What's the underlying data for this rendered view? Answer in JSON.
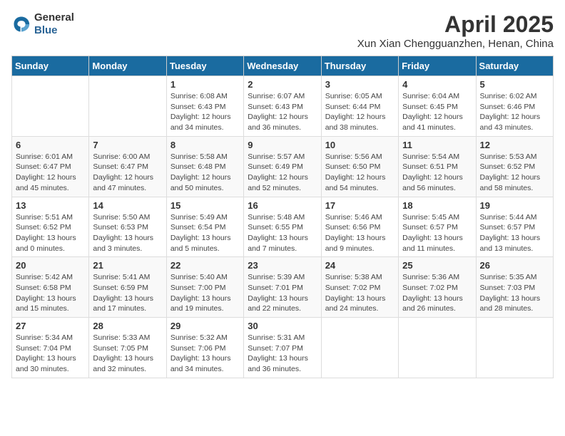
{
  "header": {
    "logo_line1": "General",
    "logo_line2": "Blue",
    "title": "April 2025",
    "subtitle": "Xun Xian Chengguanzhen, Henan, China"
  },
  "weekdays": [
    "Sunday",
    "Monday",
    "Tuesday",
    "Wednesday",
    "Thursday",
    "Friday",
    "Saturday"
  ],
  "weeks": [
    [
      {
        "day": "",
        "info": ""
      },
      {
        "day": "",
        "info": ""
      },
      {
        "day": "1",
        "info": "Sunrise: 6:08 AM\nSunset: 6:43 PM\nDaylight: 12 hours\nand 34 minutes."
      },
      {
        "day": "2",
        "info": "Sunrise: 6:07 AM\nSunset: 6:43 PM\nDaylight: 12 hours\nand 36 minutes."
      },
      {
        "day": "3",
        "info": "Sunrise: 6:05 AM\nSunset: 6:44 PM\nDaylight: 12 hours\nand 38 minutes."
      },
      {
        "day": "4",
        "info": "Sunrise: 6:04 AM\nSunset: 6:45 PM\nDaylight: 12 hours\nand 41 minutes."
      },
      {
        "day": "5",
        "info": "Sunrise: 6:02 AM\nSunset: 6:46 PM\nDaylight: 12 hours\nand 43 minutes."
      }
    ],
    [
      {
        "day": "6",
        "info": "Sunrise: 6:01 AM\nSunset: 6:47 PM\nDaylight: 12 hours\nand 45 minutes."
      },
      {
        "day": "7",
        "info": "Sunrise: 6:00 AM\nSunset: 6:47 PM\nDaylight: 12 hours\nand 47 minutes."
      },
      {
        "day": "8",
        "info": "Sunrise: 5:58 AM\nSunset: 6:48 PM\nDaylight: 12 hours\nand 50 minutes."
      },
      {
        "day": "9",
        "info": "Sunrise: 5:57 AM\nSunset: 6:49 PM\nDaylight: 12 hours\nand 52 minutes."
      },
      {
        "day": "10",
        "info": "Sunrise: 5:56 AM\nSunset: 6:50 PM\nDaylight: 12 hours\nand 54 minutes."
      },
      {
        "day": "11",
        "info": "Sunrise: 5:54 AM\nSunset: 6:51 PM\nDaylight: 12 hours\nand 56 minutes."
      },
      {
        "day": "12",
        "info": "Sunrise: 5:53 AM\nSunset: 6:52 PM\nDaylight: 12 hours\nand 58 minutes."
      }
    ],
    [
      {
        "day": "13",
        "info": "Sunrise: 5:51 AM\nSunset: 6:52 PM\nDaylight: 13 hours\nand 0 minutes."
      },
      {
        "day": "14",
        "info": "Sunrise: 5:50 AM\nSunset: 6:53 PM\nDaylight: 13 hours\nand 3 minutes."
      },
      {
        "day": "15",
        "info": "Sunrise: 5:49 AM\nSunset: 6:54 PM\nDaylight: 13 hours\nand 5 minutes."
      },
      {
        "day": "16",
        "info": "Sunrise: 5:48 AM\nSunset: 6:55 PM\nDaylight: 13 hours\nand 7 minutes."
      },
      {
        "day": "17",
        "info": "Sunrise: 5:46 AM\nSunset: 6:56 PM\nDaylight: 13 hours\nand 9 minutes."
      },
      {
        "day": "18",
        "info": "Sunrise: 5:45 AM\nSunset: 6:57 PM\nDaylight: 13 hours\nand 11 minutes."
      },
      {
        "day": "19",
        "info": "Sunrise: 5:44 AM\nSunset: 6:57 PM\nDaylight: 13 hours\nand 13 minutes."
      }
    ],
    [
      {
        "day": "20",
        "info": "Sunrise: 5:42 AM\nSunset: 6:58 PM\nDaylight: 13 hours\nand 15 minutes."
      },
      {
        "day": "21",
        "info": "Sunrise: 5:41 AM\nSunset: 6:59 PM\nDaylight: 13 hours\nand 17 minutes."
      },
      {
        "day": "22",
        "info": "Sunrise: 5:40 AM\nSunset: 7:00 PM\nDaylight: 13 hours\nand 19 minutes."
      },
      {
        "day": "23",
        "info": "Sunrise: 5:39 AM\nSunset: 7:01 PM\nDaylight: 13 hours\nand 22 minutes."
      },
      {
        "day": "24",
        "info": "Sunrise: 5:38 AM\nSunset: 7:02 PM\nDaylight: 13 hours\nand 24 minutes."
      },
      {
        "day": "25",
        "info": "Sunrise: 5:36 AM\nSunset: 7:02 PM\nDaylight: 13 hours\nand 26 minutes."
      },
      {
        "day": "26",
        "info": "Sunrise: 5:35 AM\nSunset: 7:03 PM\nDaylight: 13 hours\nand 28 minutes."
      }
    ],
    [
      {
        "day": "27",
        "info": "Sunrise: 5:34 AM\nSunset: 7:04 PM\nDaylight: 13 hours\nand 30 minutes."
      },
      {
        "day": "28",
        "info": "Sunrise: 5:33 AM\nSunset: 7:05 PM\nDaylight: 13 hours\nand 32 minutes."
      },
      {
        "day": "29",
        "info": "Sunrise: 5:32 AM\nSunset: 7:06 PM\nDaylight: 13 hours\nand 34 minutes."
      },
      {
        "day": "30",
        "info": "Sunrise: 5:31 AM\nSunset: 7:07 PM\nDaylight: 13 hours\nand 36 minutes."
      },
      {
        "day": "",
        "info": ""
      },
      {
        "day": "",
        "info": ""
      },
      {
        "day": "",
        "info": ""
      }
    ]
  ]
}
